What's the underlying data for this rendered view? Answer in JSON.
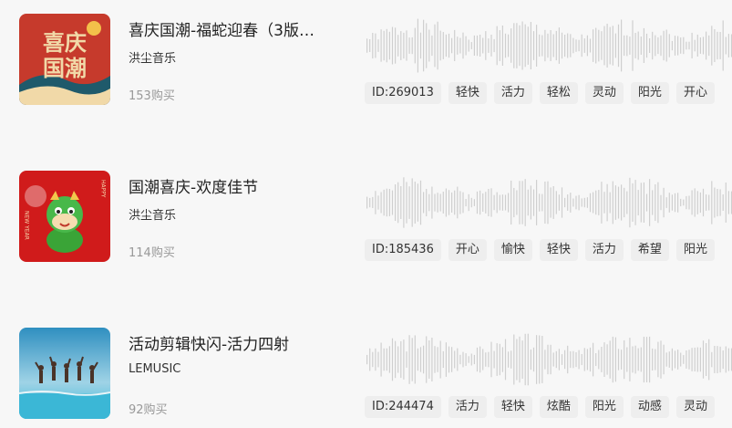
{
  "tracks": [
    {
      "title": "喜庆国潮-福蛇迎春（3版…",
      "artist": "洪尘音乐",
      "buys": "153购买",
      "tags": [
        "ID:269013",
        "轻快",
        "活力",
        "轻松",
        "灵动",
        "阳光",
        "开心"
      ],
      "cover": {
        "main": "#c63a2c",
        "accent": "#f1d9a8",
        "text": [
          "喜庆",
          "国潮"
        ]
      }
    },
    {
      "title": "国潮喜庆-欢度佳节",
      "artist": "洪尘音乐",
      "buys": "114购买",
      "tags": [
        "ID:185436",
        "开心",
        "愉快",
        "轻快",
        "活力",
        "希望",
        "阳光"
      ],
      "cover": {
        "main": "#d01b1b",
        "accent": "#3aa437",
        "text": [
          "HAPPY",
          "NEW YEAR"
        ]
      }
    },
    {
      "title": "活动剪辑快闪-活力四射",
      "artist": "LEMUSIC",
      "buys": "92购买",
      "tags": [
        "ID:244474",
        "活力",
        "轻快",
        "炫酷",
        "阳光",
        "动感",
        "灵动"
      ],
      "cover": {
        "main": "#3aa9cf",
        "accent": "#e9f4f8"
      }
    }
  ],
  "colors": {
    "background": "#f7f7f7",
    "waveform": "#cfcfcf",
    "tag_bg": "#eeeeee"
  }
}
